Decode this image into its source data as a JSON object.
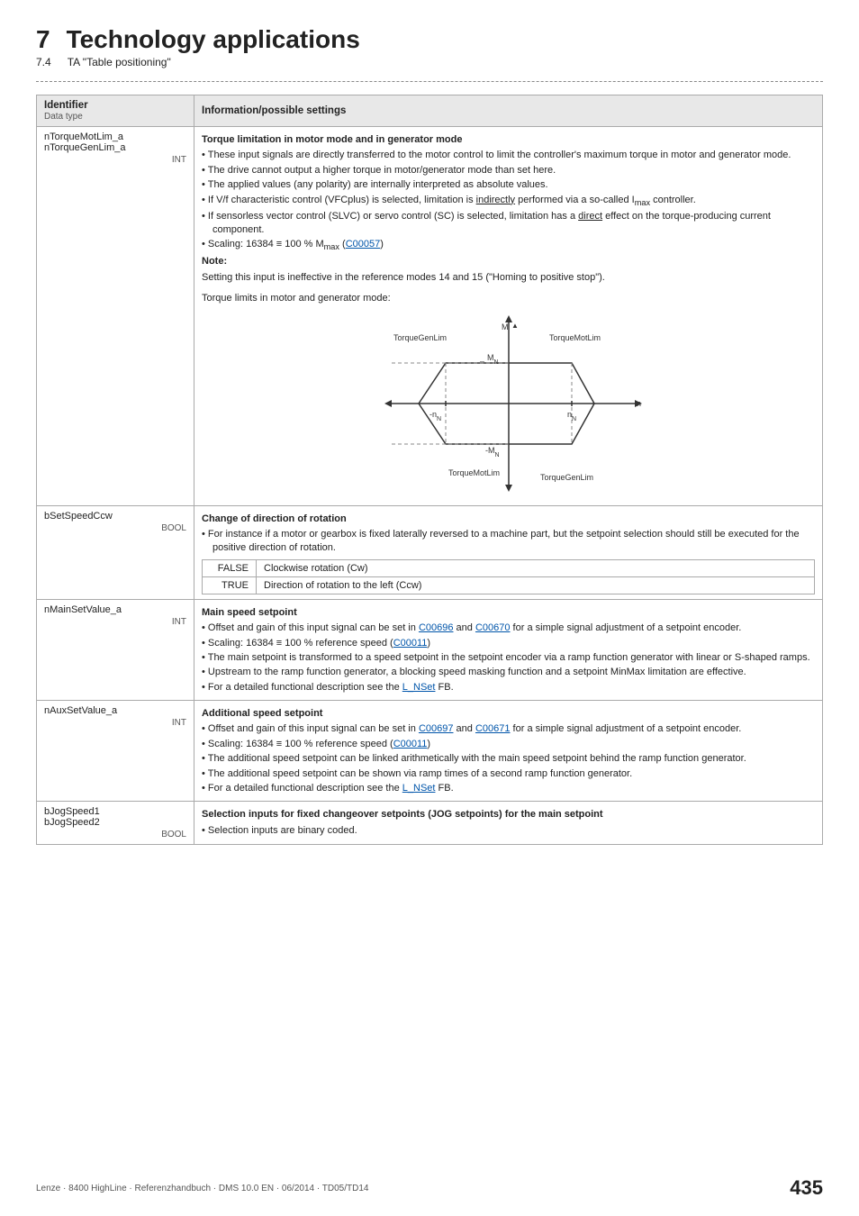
{
  "chapter": {
    "number": "7",
    "title": "Technology applications",
    "sub_number": "7.4",
    "sub_title": "TA \"Table positioning\""
  },
  "table": {
    "col_identifier": "Identifier",
    "col_data_type": "Data type",
    "col_info": "Information/possible settings",
    "rows": [
      {
        "id": "nTorqueMotLim_a\nnTorqueGenLim_a",
        "data_type": "INT",
        "info_title": "Torque limitation in motor mode and in generator mode",
        "info_bullets": [
          "These input signals are directly transferred to the motor control to limit the controller's maximum torque in motor and generator mode.",
          "The drive cannot output a higher torque in motor/generator mode than set here.",
          "The applied values (any polarity) are internally interpreted as absolute values.",
          "If V/f characteristic control (VFCplus) is selected, limitation is indirectly performed via a so-called I_max controller.",
          "If sensorless vector control (SLVC) or servo control (SC) is selected, limitation has a direct effect on the torque-producing current component.",
          "Scaling: 16384 ≡ 100 % M_max (C00057)"
        ],
        "note_label": "Note:",
        "note_text": "Setting this input is ineffective in the reference modes 14 and 15 (\"Homing to positive stop\").",
        "chart_title": "Torque limits in motor and generator mode:",
        "has_chart": true
      },
      {
        "id": "bSetSpeedCcw",
        "data_type": "BOOL",
        "info_title": "Change of direction of rotation",
        "info_bullets": [
          "For instance if a motor or gearbox is fixed laterally reversed to a machine part, but the setpoint selection should still be executed for the positive direction of rotation."
        ],
        "sub_rows": [
          {
            "label": "FALSE",
            "value": "Clockwise rotation (Cw)"
          },
          {
            "label": "TRUE",
            "value": "Direction of rotation to the left (Ccw)"
          }
        ]
      },
      {
        "id": "nMainSetValue_a",
        "data_type": "INT",
        "info_title": "Main speed setpoint",
        "info_bullets": [
          "Offset and gain of this input signal can be set in C00696 and C00670 for a simple signal adjustment of a setpoint encoder.",
          "Scaling: 16384 ≡ 100 % reference speed (C00011)",
          "The main setpoint is transformed to a speed setpoint in the setpoint encoder via a ramp function generator with linear or S-shaped ramps.",
          "Upstream to the ramp function generator, a blocking speed masking function and a setpoint MinMax limitation are effective.",
          "For a detailed functional description see the L_NSet FB."
        ]
      },
      {
        "id": "nAuxSetValue_a",
        "data_type": "INT",
        "info_title": "Additional speed setpoint",
        "info_bullets": [
          "Offset and gain of this input signal can be set in C00697 and C00671 for a simple signal adjustment of a setpoint encoder.",
          "Scaling: 16384 ≡ 100 % reference speed (C00011)",
          "The additional speed setpoint can be linked arithmetically with the main speed setpoint behind the ramp function generator.",
          "The additional speed setpoint can be shown via ramp times of a second ramp function generator.",
          "For a detailed functional description see the L_NSet FB."
        ]
      },
      {
        "id": "bJogSpeed1\nbJogSpeed2",
        "data_type": "BOOL",
        "info_title": "Selection inputs for fixed changeover setpoints (JOG setpoints) for the main setpoint",
        "info_bullets": [
          "Selection inputs are binary coded."
        ]
      }
    ]
  },
  "footer": {
    "left": "Lenze · 8400 HighLine · Referenzhandbuch · DMS 10.0 EN · 06/2014 · TD05/TD14",
    "page": "435"
  },
  "links": {
    "C00057": "C00057",
    "C00696": "C00696",
    "C00670": "C00670",
    "C00011_1": "C00011",
    "C00697": "C00697",
    "C00671": "C00671",
    "C00011_2": "C00011",
    "L_NSet_1": "L_NSet",
    "L_NSet_2": "L_NSet"
  }
}
